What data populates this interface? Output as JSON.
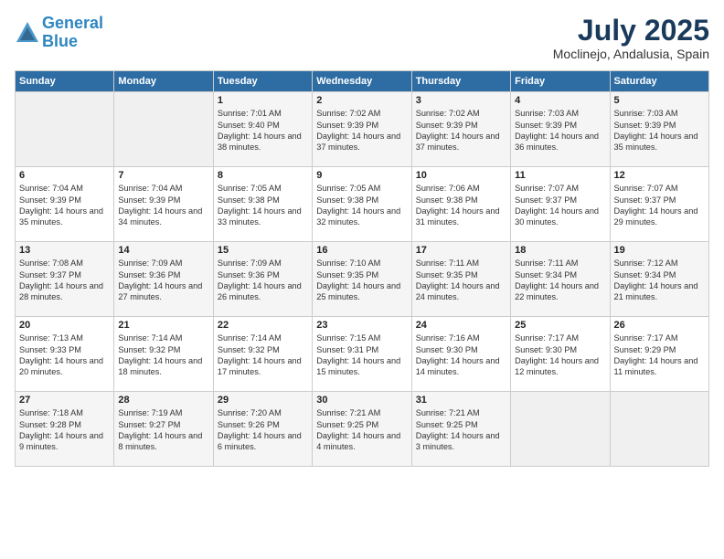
{
  "header": {
    "logo_line1": "General",
    "logo_line2": "Blue",
    "month_year": "July 2025",
    "location": "Moclinejo, Andalusia, Spain"
  },
  "days_of_week": [
    "Sunday",
    "Monday",
    "Tuesday",
    "Wednesday",
    "Thursday",
    "Friday",
    "Saturday"
  ],
  "weeks": [
    [
      {
        "day": "",
        "empty": true
      },
      {
        "day": "",
        "empty": true
      },
      {
        "day": "1",
        "sunrise": "7:01 AM",
        "sunset": "9:40 PM",
        "daylight": "14 hours and 38 minutes."
      },
      {
        "day": "2",
        "sunrise": "7:02 AM",
        "sunset": "9:39 PM",
        "daylight": "14 hours and 37 minutes."
      },
      {
        "day": "3",
        "sunrise": "7:02 AM",
        "sunset": "9:39 PM",
        "daylight": "14 hours and 37 minutes."
      },
      {
        "day": "4",
        "sunrise": "7:03 AM",
        "sunset": "9:39 PM",
        "daylight": "14 hours and 36 minutes."
      },
      {
        "day": "5",
        "sunrise": "7:03 AM",
        "sunset": "9:39 PM",
        "daylight": "14 hours and 35 minutes."
      }
    ],
    [
      {
        "day": "6",
        "sunrise": "7:04 AM",
        "sunset": "9:39 PM",
        "daylight": "14 hours and 35 minutes."
      },
      {
        "day": "7",
        "sunrise": "7:04 AM",
        "sunset": "9:39 PM",
        "daylight": "14 hours and 34 minutes."
      },
      {
        "day": "8",
        "sunrise": "7:05 AM",
        "sunset": "9:38 PM",
        "daylight": "14 hours and 33 minutes."
      },
      {
        "day": "9",
        "sunrise": "7:05 AM",
        "sunset": "9:38 PM",
        "daylight": "14 hours and 32 minutes."
      },
      {
        "day": "10",
        "sunrise": "7:06 AM",
        "sunset": "9:38 PM",
        "daylight": "14 hours and 31 minutes."
      },
      {
        "day": "11",
        "sunrise": "7:07 AM",
        "sunset": "9:37 PM",
        "daylight": "14 hours and 30 minutes."
      },
      {
        "day": "12",
        "sunrise": "7:07 AM",
        "sunset": "9:37 PM",
        "daylight": "14 hours and 29 minutes."
      }
    ],
    [
      {
        "day": "13",
        "sunrise": "7:08 AM",
        "sunset": "9:37 PM",
        "daylight": "14 hours and 28 minutes."
      },
      {
        "day": "14",
        "sunrise": "7:09 AM",
        "sunset": "9:36 PM",
        "daylight": "14 hours and 27 minutes."
      },
      {
        "day": "15",
        "sunrise": "7:09 AM",
        "sunset": "9:36 PM",
        "daylight": "14 hours and 26 minutes."
      },
      {
        "day": "16",
        "sunrise": "7:10 AM",
        "sunset": "9:35 PM",
        "daylight": "14 hours and 25 minutes."
      },
      {
        "day": "17",
        "sunrise": "7:11 AM",
        "sunset": "9:35 PM",
        "daylight": "14 hours and 24 minutes."
      },
      {
        "day": "18",
        "sunrise": "7:11 AM",
        "sunset": "9:34 PM",
        "daylight": "14 hours and 22 minutes."
      },
      {
        "day": "19",
        "sunrise": "7:12 AM",
        "sunset": "9:34 PM",
        "daylight": "14 hours and 21 minutes."
      }
    ],
    [
      {
        "day": "20",
        "sunrise": "7:13 AM",
        "sunset": "9:33 PM",
        "daylight": "14 hours and 20 minutes."
      },
      {
        "day": "21",
        "sunrise": "7:14 AM",
        "sunset": "9:32 PM",
        "daylight": "14 hours and 18 minutes."
      },
      {
        "day": "22",
        "sunrise": "7:14 AM",
        "sunset": "9:32 PM",
        "daylight": "14 hours and 17 minutes."
      },
      {
        "day": "23",
        "sunrise": "7:15 AM",
        "sunset": "9:31 PM",
        "daylight": "14 hours and 15 minutes."
      },
      {
        "day": "24",
        "sunrise": "7:16 AM",
        "sunset": "9:30 PM",
        "daylight": "14 hours and 14 minutes."
      },
      {
        "day": "25",
        "sunrise": "7:17 AM",
        "sunset": "9:30 PM",
        "daylight": "14 hours and 12 minutes."
      },
      {
        "day": "26",
        "sunrise": "7:17 AM",
        "sunset": "9:29 PM",
        "daylight": "14 hours and 11 minutes."
      }
    ],
    [
      {
        "day": "27",
        "sunrise": "7:18 AM",
        "sunset": "9:28 PM",
        "daylight": "14 hours and 9 minutes."
      },
      {
        "day": "28",
        "sunrise": "7:19 AM",
        "sunset": "9:27 PM",
        "daylight": "14 hours and 8 minutes."
      },
      {
        "day": "29",
        "sunrise": "7:20 AM",
        "sunset": "9:26 PM",
        "daylight": "14 hours and 6 minutes."
      },
      {
        "day": "30",
        "sunrise": "7:21 AM",
        "sunset": "9:25 PM",
        "daylight": "14 hours and 4 minutes."
      },
      {
        "day": "31",
        "sunrise": "7:21 AM",
        "sunset": "9:25 PM",
        "daylight": "14 hours and 3 minutes."
      },
      {
        "day": "",
        "empty": true
      },
      {
        "day": "",
        "empty": true
      }
    ]
  ]
}
